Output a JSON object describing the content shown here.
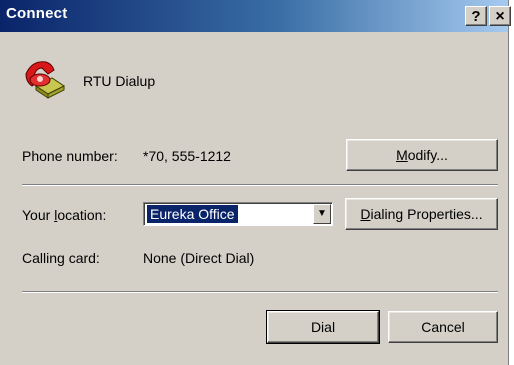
{
  "window": {
    "title": "Connect",
    "help_label": "?",
    "close_label": "×"
  },
  "connection": {
    "name": "RTU Dialup",
    "icon": "phone-modem-icon"
  },
  "phone": {
    "label_text": "Phone number:",
    "value": "*70, 555-1212",
    "modify_prefix": "",
    "modify_key": "M",
    "modify_rest": "odify..."
  },
  "location": {
    "label_prefix": "Your ",
    "label_key": "l",
    "label_rest": "ocation:",
    "selected": "Eureka Office",
    "dialing_key": "D",
    "dialing_rest": "ialing Properties..."
  },
  "calling_card": {
    "label_text": "Calling card:",
    "value": "None (Direct Dial)"
  },
  "actions": {
    "dial_label": "Dial",
    "cancel_label": "Cancel"
  }
}
